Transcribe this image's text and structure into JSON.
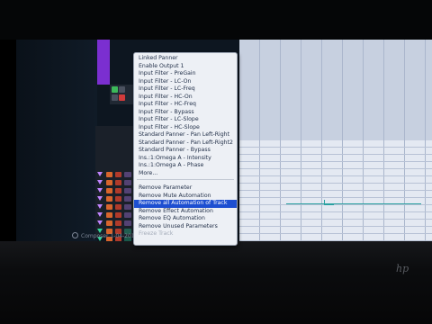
{
  "context_menu": {
    "items": [
      {
        "label": "Linked Panner",
        "state": "normal"
      },
      {
        "label": "Enable Output 1",
        "state": "normal"
      },
      {
        "label": "Input Filter - PreGain",
        "state": "normal"
      },
      {
        "label": "Input Filter - LC-On",
        "state": "normal"
      },
      {
        "label": "Input Filter - LC-Freq",
        "state": "normal"
      },
      {
        "label": "Input Filter - HC-On",
        "state": "normal"
      },
      {
        "label": "Input Filter - HC-Freq",
        "state": "normal"
      },
      {
        "label": "Input Filter - Bypass",
        "state": "normal"
      },
      {
        "label": "Input Filter - LC-Slope",
        "state": "normal"
      },
      {
        "label": "Input Filter - HC-Slope",
        "state": "normal"
      },
      {
        "label": "Standard Panner - Pan Left-Right",
        "state": "normal"
      },
      {
        "label": "Standard Panner - Pan Left-Right2",
        "state": "normal"
      },
      {
        "label": "Standard Panner - Bypass",
        "state": "normal"
      },
      {
        "label": "Ins.:1:Omega A - Intensity",
        "state": "normal"
      },
      {
        "label": "Ins.:1:Omega A - Phase",
        "state": "normal"
      },
      {
        "label": "More...",
        "state": "normal"
      },
      {
        "label": "Remove Parameter",
        "state": "normal"
      },
      {
        "label": "Remove Mute Automation",
        "state": "normal"
      },
      {
        "label": "Remove all Automation of Track",
        "state": "highlighted"
      },
      {
        "label": "Remove Effect Automation",
        "state": "normal"
      },
      {
        "label": "Remove EQ Automation",
        "state": "normal"
      },
      {
        "label": "Remove Unused Parameters",
        "state": "normal"
      },
      {
        "label": "Freeze Track",
        "state": "disabled"
      }
    ]
  },
  "status_bar": {
    "label": "Composer 1-04-2017"
  },
  "tracks": {
    "colors": [
      "#c084ff",
      "#c084ff",
      "#c084ff",
      "#c084ff",
      "#c084ff",
      "#c084ff",
      "#c084ff",
      "#35d49a",
      "#35d49a",
      "#35d49a",
      "#f6e84a",
      "#e44a5a",
      "#c084ff"
    ]
  },
  "watermark": {
    "text": "hp"
  }
}
